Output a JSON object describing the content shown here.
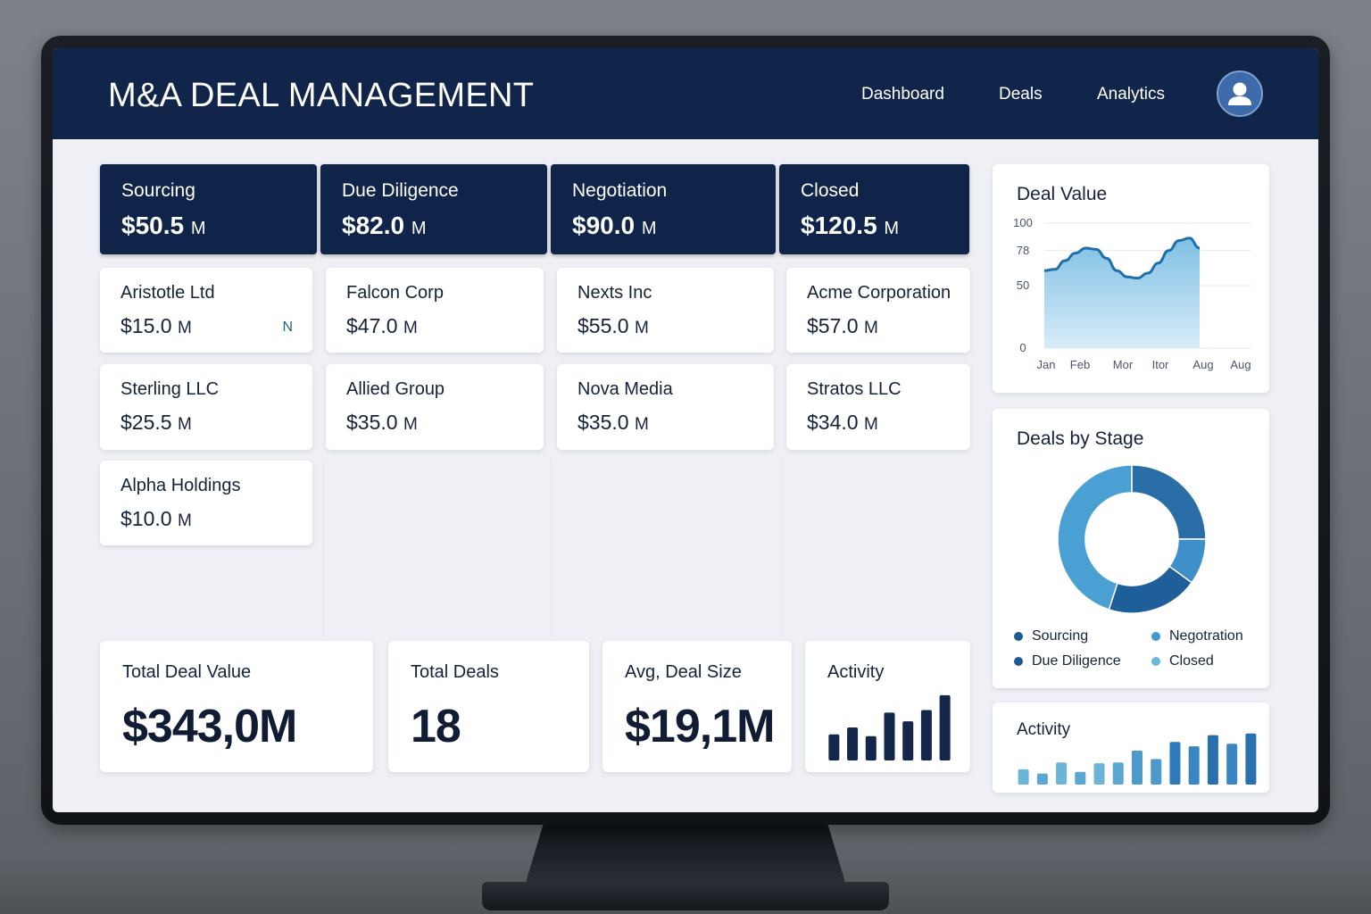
{
  "app": {
    "title": "M&A DEAL MANAGEMENT",
    "nav": [
      "Dashboard",
      "Deals",
      "Analytics"
    ],
    "avatar_icon": "user-icon"
  },
  "stages": [
    {
      "name": "Sourcing",
      "value": "$50.5",
      "unit": "M"
    },
    {
      "name": "Due Diligence",
      "value": "$82.0",
      "unit": "M"
    },
    {
      "name": "Negotiation",
      "value": "$90.0",
      "unit": "M"
    },
    {
      "name": "Closed",
      "value": "$120.5",
      "unit": "M"
    }
  ],
  "deals": [
    [
      {
        "name": "Aristotle Ltd",
        "value": "$15.0",
        "unit": "M",
        "badge": "N"
      },
      {
        "name": "Sterling LLC",
        "value": "$25.5",
        "unit": "M"
      },
      {
        "name": "Alpha Holdings",
        "value": "$10.0",
        "unit": "M"
      }
    ],
    [
      {
        "name": "Falcon Corp",
        "value": "$47.0",
        "unit": "M"
      },
      {
        "name": "Allied Group",
        "value": "$35.0",
        "unit": "M"
      }
    ],
    [
      {
        "name": "Nexts Inc",
        "value": "$55.0",
        "unit": "M"
      },
      {
        "name": "Nova Media",
        "value": "$35.0",
        "unit": "M"
      }
    ],
    [
      {
        "name": "Acme Corporation",
        "value": "$57.0",
        "unit": "M"
      },
      {
        "name": "Stratos LLC",
        "value": "$34.0",
        "unit": "M"
      }
    ]
  ],
  "kpis": {
    "total_value": {
      "label": "Total Deal Value",
      "value": "$343,0M"
    },
    "total_deals": {
      "label": "Total Deals",
      "value": "18"
    },
    "avg_size": {
      "label": "Avg, Deal Size",
      "value": "$19,1M"
    },
    "activity": {
      "label": "Activity"
    }
  },
  "chart_data": [
    {
      "type": "area",
      "title": "Deal Value",
      "x": [
        "Jan",
        "Feb",
        "Mor",
        "Itor",
        "Aug",
        "Aug"
      ],
      "y_ticks": [
        "100",
        "78",
        "50",
        "0"
      ],
      "y_tick_values": [
        100,
        78,
        50,
        0
      ],
      "ylim": [
        0,
        100
      ],
      "series": [
        {
          "values": [
            [
              0,
              62
            ],
            [
              0.25,
              63
            ],
            [
              0.5,
              70
            ],
            [
              0.75,
              76
            ],
            [
              1,
              80
            ],
            [
              1.25,
              79
            ],
            [
              1.5,
              72
            ],
            [
              1.75,
              62
            ],
            [
              2,
              57
            ],
            [
              2.25,
              56
            ],
            [
              2.5,
              60
            ],
            [
              2.75,
              68
            ],
            [
              3,
              78
            ],
            [
              3.25,
              86
            ],
            [
              3.5,
              88
            ],
            [
              3.75,
              80
            ]
          ]
        }
      ],
      "color": "#1f6faa"
    },
    {
      "type": "pie",
      "title": "Deals by Stage",
      "donut": true,
      "slices": [
        {
          "label": "Sourcing",
          "value": 25,
          "color": "#2a6ea7"
        },
        {
          "label": "Negotration",
          "value": 10,
          "color": "#3f8fcb"
        },
        {
          "label": "Due Diligence",
          "value": 20,
          "color": "#1f5f99"
        },
        {
          "label": "Closed",
          "value": 45,
          "color": "#4aa0d3"
        }
      ],
      "legend": [
        {
          "label": "Sourcing",
          "color": "#1e5a92"
        },
        {
          "label": "Negotration",
          "color": "#3f9ad0"
        },
        {
          "label": "Due Diligence",
          "color": "#1e5a92"
        },
        {
          "label": "Closed",
          "color": "#6cb6db"
        }
      ]
    },
    {
      "type": "bar",
      "title": "Activity",
      "values": [
        30,
        38,
        28,
        55,
        45,
        58,
        75
      ],
      "ylim": [
        0,
        80
      ],
      "color": "#14274b"
    },
    {
      "type": "bar",
      "title": "Activity",
      "values": [
        18,
        13,
        26,
        15,
        25,
        26,
        40,
        30,
        50,
        45,
        58,
        48,
        60
      ],
      "ylim": [
        0,
        65
      ],
      "colors": [
        "#6cb4d8",
        "#5aa7d2",
        "#6cb4d8",
        "#5aa7d2",
        "#6cb4d8",
        "#5aa7d2",
        "#4c9bcc",
        "#4c9bcc",
        "#2f7ab8",
        "#3a86c2",
        "#2a6fae",
        "#3a86c2",
        "#2a6fae"
      ]
    }
  ]
}
